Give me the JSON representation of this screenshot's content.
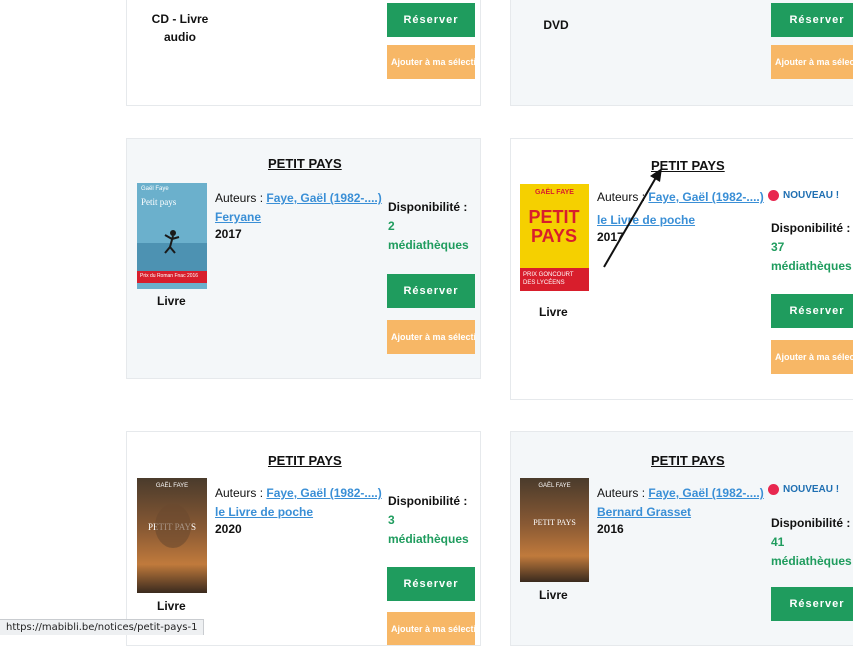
{
  "cards": [
    {
      "doctype_lines": [
        "CD - Livre",
        "audio"
      ],
      "reserve_label": "Réserver",
      "select_label": "Ajouter à ma sélection"
    },
    {
      "doctype": "DVD",
      "reserve_label": "Réserver",
      "select_label": "Ajouter à ma sélection"
    },
    {
      "title": "PETIT PAYS",
      "authors_label": "Auteurs :",
      "author": "Faye, Gaël (1982-....)",
      "publisher": "Feryane",
      "year": "2017",
      "doctype": "Livre",
      "availability_label": "Disponibilité :",
      "count": "2",
      "unit": "médiathèques",
      "reserve_label": "Réserver",
      "select_label": "Ajouter à ma sélection",
      "cover": {
        "top_text": "Gaël Faye",
        "title": "Petit pays",
        "band": "Prix du Roman Fnac 2016",
        "palette": [
          "#5fa9c8",
          "#d81e2c"
        ]
      }
    },
    {
      "title": "PETIT PAYS",
      "authors_label": "Auteurs :",
      "author": "Faye, Gaël (1982-....)",
      "publisher": "le Livre de poche",
      "year": "2017",
      "doctype": "Livre",
      "new_label": "NOUVEAU !",
      "availability_label": "Disponibilité :",
      "count": "37",
      "unit": "médiathèques",
      "reserve_label": "Réserver",
      "select_label": "Ajouter à ma sélection",
      "cover": {
        "top_text": "GAËL FAYE",
        "title": "PETIT PAYS",
        "band": "PRIX GONCOURT DES LYCÉENS",
        "palette": [
          "#f5d000",
          "#d81e2c"
        ]
      }
    },
    {
      "title": "PETIT PAYS",
      "authors_label": "Auteurs :",
      "author": "Faye, Gaël (1982-....)",
      "publisher": "le Livre de poche",
      "year": "2020",
      "doctype": "Livre",
      "availability_label": "Disponibilité :",
      "count": "3",
      "unit": "médiathèques",
      "reserve_label": "Réserver",
      "select_label": "Ajouter à ma sélection",
      "cover": {
        "top_text": "GAËL FAYE",
        "title": "PETIT PAYS",
        "palette": [
          "#3a3024",
          "#b8743a"
        ]
      }
    },
    {
      "title": "PETIT PAYS",
      "authors_label": "Auteurs :",
      "author": "Faye, Gaël (1982-....)",
      "publisher": "Bernard Grasset",
      "year": "2016",
      "doctype": "Livre",
      "new_label": "NOUVEAU !",
      "availability_label": "Disponibilité :",
      "count": "41",
      "unit": "médiathèques",
      "reserve_label": "Réserver",
      "cover": {
        "top_text": "GAËL FAYE",
        "title": "PETIT PAYS",
        "palette": [
          "#3a3024",
          "#b8743a"
        ]
      }
    }
  ],
  "status_url": "https://mabibli.be/notices/petit-pays-1"
}
